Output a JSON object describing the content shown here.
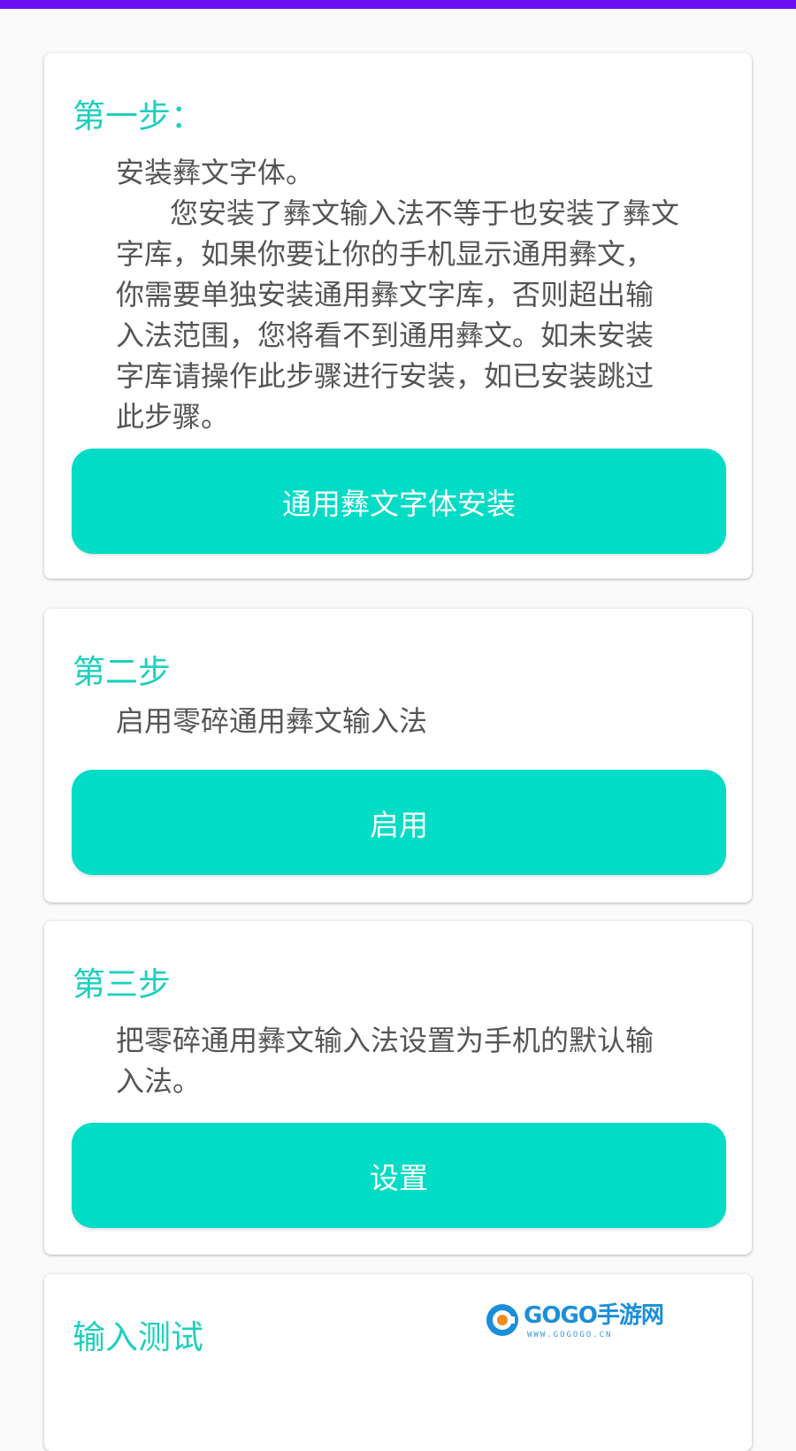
{
  "colors": {
    "status_bar": "#6a0ff0",
    "accent_title": "#1ecfbd",
    "button": "#00dcc5",
    "body_text": "#555555",
    "background": "#fafafa"
  },
  "steps": [
    {
      "title": "第一步：",
      "description_lines": [
        "安装彝文字体。",
        "      您安装了彝文输入法不等于也安装了彝文",
        "字库，如果你要让你的手机显示通用彝文，",
        "你需要单独安装通用彝文字库，否则超出输",
        "入法范围，您将看不到通用彝文。如未安装",
        "字库请操作此步骤进行安装，如已安装跳过",
        "此步骤。"
      ],
      "button_label": "通用彝文字体安装"
    },
    {
      "title": "第二步",
      "description_lines": [
        "启用零碎通用彝文输入法"
      ],
      "button_label": "启用"
    },
    {
      "title": "第三步",
      "description_lines": [
        "把零碎通用彝文输入法设置为手机的默认输",
        "入法。"
      ],
      "button_label": "设置"
    }
  ],
  "input_test": {
    "title": "输入测试"
  },
  "watermark": {
    "brand": "GOGO手游网",
    "url": "WWW.GOGOGO.CN",
    "icon": "gogo-logo-icon"
  }
}
